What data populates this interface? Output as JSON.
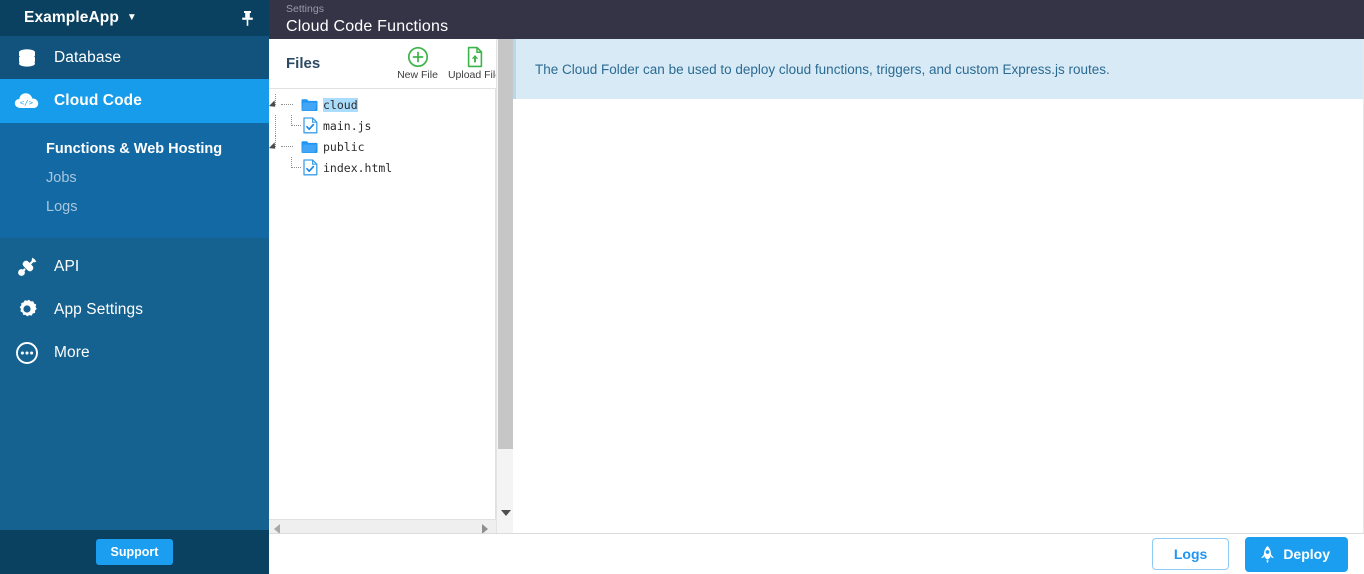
{
  "sidebar": {
    "app_name": "ExampleApp",
    "app_caret": "▼",
    "pin_icon": "pushpin-icon",
    "nav": [
      {
        "label": "Database",
        "icon": "database-icon",
        "state": "hover"
      },
      {
        "label": "Cloud Code",
        "icon": "cloud-code-icon",
        "state": "active"
      },
      {
        "label": "API",
        "icon": "api-plug-icon",
        "state": "normal"
      },
      {
        "label": "App Settings",
        "icon": "gear-icon",
        "state": "normal"
      },
      {
        "label": "More",
        "icon": "ellipsis-circle-icon",
        "state": "normal"
      }
    ],
    "submenu": [
      {
        "label": "Functions & Web Hosting",
        "selected": true
      },
      {
        "label": "Jobs",
        "selected": false
      },
      {
        "label": "Logs",
        "selected": false
      }
    ],
    "support_label": "Support"
  },
  "titlebar": {
    "breadcrumb": "Settings",
    "title": "Cloud Code Functions"
  },
  "files_panel": {
    "heading": "Files",
    "actions": [
      {
        "label": "New File",
        "icon": "plus-circle-icon"
      },
      {
        "label": "Upload File",
        "icon": "upload-file-icon"
      }
    ],
    "tree": [
      {
        "name": "cloud",
        "type": "folder",
        "depth": 0,
        "selected": true,
        "expanded": true
      },
      {
        "name": "main.js",
        "type": "file",
        "depth": 1,
        "selected": false
      },
      {
        "name": "public",
        "type": "folder",
        "depth": 0,
        "selected": false,
        "expanded": true
      },
      {
        "name": "index.html",
        "type": "file",
        "depth": 1,
        "selected": false
      }
    ]
  },
  "content": {
    "banner_text": "The Cloud Folder can be used to deploy cloud functions, triggers, and custom Express.js routes."
  },
  "bottombar": {
    "logs_label": "Logs",
    "deploy_label": "Deploy",
    "deploy_icon": "rocket-icon"
  },
  "colors": {
    "sidebar_base": "#15618f",
    "sidebar_header": "#0b4160",
    "nav_hover": "#12537d",
    "nav_active": "#169ceb",
    "submenu_bg": "#1269a4",
    "titlebar": "#343446",
    "banner_bg": "#d7eaf5",
    "banner_text": "#2b6b93",
    "accent_blue": "#1b9df0",
    "action_green": "#3cb44a",
    "folder_blue": "#2196f3",
    "selection_blue": "#aadcfb"
  }
}
